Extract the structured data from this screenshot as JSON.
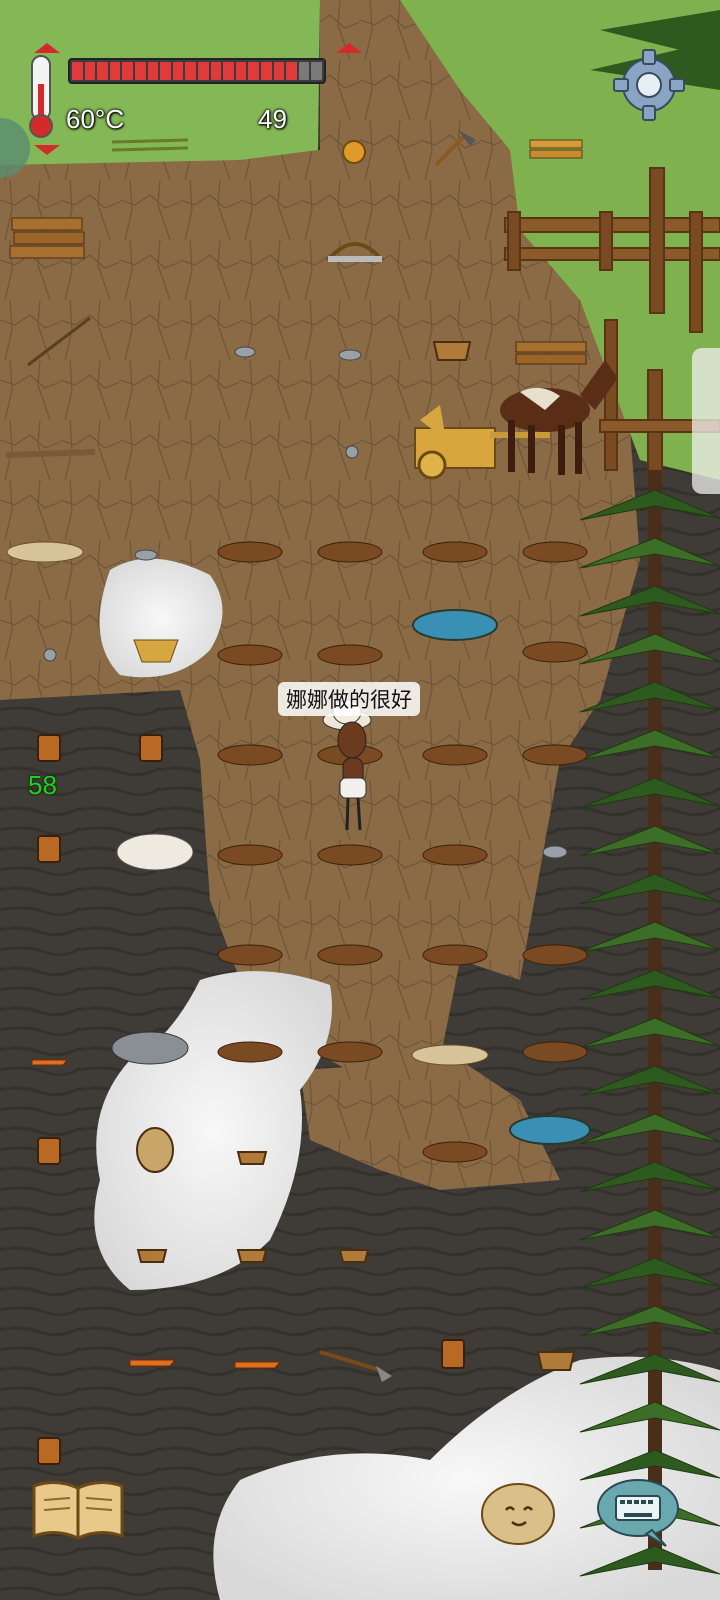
{
  "hud": {
    "temperature": "60°C",
    "food_count": "49",
    "heat_number": "58",
    "hunger_level": 0.9,
    "hunger_segments": 20
  },
  "speech": {
    "text": "娜娜做的很好"
  },
  "icons": {
    "thermometer": "thermometer-icon",
    "settings": "gear-icon",
    "recipe_book": "book-icon",
    "emote": "potato-face-icon",
    "chat": "keyboard-bubble-icon"
  },
  "colors": {
    "hunger_fill": "#e03a3a",
    "hunger_empty": "#7a7a7a",
    "heat_text": "#1bd41b",
    "grass": "#7fb24e",
    "dirt": "#8a6b45",
    "dark_ground": "#3e3a35",
    "snow": "#efefef"
  }
}
